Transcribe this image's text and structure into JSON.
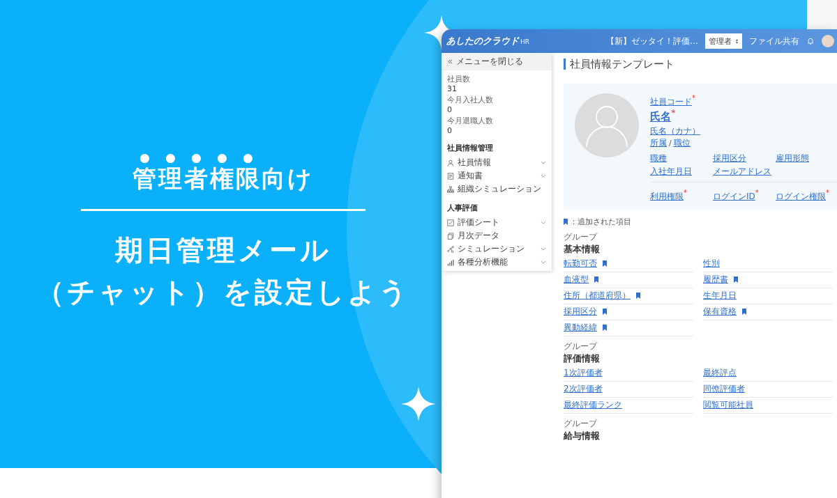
{
  "promo": {
    "badge_emphasis": "管理者権限",
    "badge_rest": "向け",
    "title_lines": [
      "期日管理メール",
      "（チャット）を設定しよう"
    ]
  },
  "app": {
    "logo": "あしたのクラウド",
    "logo_suffix": "HR",
    "header": {
      "notice": "【新】ゼッタイ！評価…",
      "role_select": "管理者",
      "file_share": "ファイル共有"
    },
    "sidebar": {
      "close_menu": "メニューを閉じる",
      "stats": [
        {
          "label": "社員数",
          "value": "31"
        },
        {
          "label": "今月入社人数",
          "value": "0"
        },
        {
          "label": "今月退職人数",
          "value": "0"
        }
      ],
      "sections": [
        {
          "title": "社員情報管理",
          "items": [
            {
              "label": "社員情報",
              "kind": "person",
              "expandable": true
            },
            {
              "label": "通知書",
              "kind": "document",
              "expandable": true
            },
            {
              "label": "組織シミュレーション",
              "kind": "org",
              "expandable": false
            }
          ]
        },
        {
          "title": "人事評価",
          "items": [
            {
              "label": "評価シート",
              "kind": "check",
              "expandable": true
            },
            {
              "label": "月次データ",
              "kind": "copy",
              "expandable": false
            },
            {
              "label": "シミュレーション",
              "kind": "nodes",
              "expandable": true
            },
            {
              "label": "各種分析機能",
              "kind": "bars",
              "expandable": true
            }
          ]
        }
      ]
    },
    "page_title": "社員情報テンプレート",
    "profile": {
      "required_mark": "*",
      "separator": "/",
      "code": {
        "label": "社員コード",
        "required": true
      },
      "name": {
        "label": "氏名",
        "required": true
      },
      "kana": "氏名（カナ）",
      "affiliation": "所属",
      "position": "職位",
      "fields": [
        {
          "label": "職種",
          "required": false
        },
        {
          "label": "採用区分",
          "required": false
        },
        {
          "label": "雇用形態",
          "required": false
        },
        {
          "label": "入社年月日",
          "required": false
        },
        {
          "label": "メールアドレス",
          "required": false
        }
      ],
      "login_fields": [
        {
          "label": "利用権限",
          "required": true
        },
        {
          "label": "ログインID",
          "required": true
        },
        {
          "label": "ログイン権限",
          "required": true
        }
      ]
    },
    "legend": "：追加された項目",
    "groups": [
      {
        "caption": "グループ",
        "title": "基本情報",
        "fields": [
          {
            "label": "転勤可否",
            "added": true
          },
          {
            "label": "性別",
            "added": false
          },
          {
            "label": "血液型",
            "added": true
          },
          {
            "label": "履歴書",
            "added": true
          },
          {
            "label": "住所（都道府県）",
            "added": true
          },
          {
            "label": "生年月日",
            "added": false
          },
          {
            "label": "採用区分",
            "added": true
          },
          {
            "label": "保有資格",
            "added": true
          },
          {
            "label": "異動経緯",
            "added": true
          }
        ]
      },
      {
        "caption": "グループ",
        "title": "評価情報",
        "fields": [
          {
            "label": "1次評価者",
            "added": false
          },
          {
            "label": "最終評点",
            "added": false
          },
          {
            "label": "2次評価者",
            "added": false
          },
          {
            "label": "同僚評価者",
            "added": false
          },
          {
            "label": "最終評価ランク",
            "added": false
          },
          {
            "label": "閲覧可能社員",
            "added": false
          }
        ]
      },
      {
        "caption": "グループ",
        "title": "給与情報"
      }
    ]
  }
}
